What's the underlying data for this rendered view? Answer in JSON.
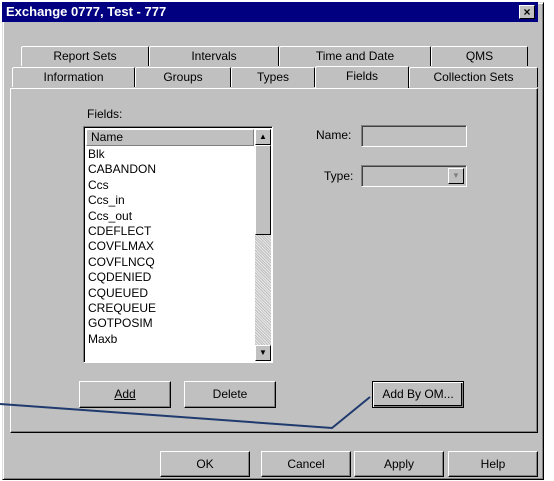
{
  "window": {
    "title": "Exchange 0777, Test - 777",
    "close_glyph": "×"
  },
  "tabs": {
    "row1": [
      "Report Sets",
      "Intervals",
      "Time and Date",
      "QMS"
    ],
    "row2": [
      "Information",
      "Groups",
      "Types",
      "Fields",
      "Collection Sets"
    ],
    "active": "Fields"
  },
  "fields_panel": {
    "list_label": "Fields:",
    "list_header": "Name",
    "items": [
      "Blk",
      "CABANDON",
      "Ccs",
      "Ccs_in",
      "Ccs_out",
      "CDEFLECT",
      "COVFLMAX",
      "COVFLNCQ",
      "CQDENIED",
      "CQUEUED",
      "CREQUEUE",
      "GOTPOSIM",
      "Maxb"
    ],
    "name_label": "Name:",
    "name_value": "",
    "type_label": "Type:",
    "type_value": "",
    "add_button": "Add",
    "delete_button": "Delete",
    "add_by_om_button": "Add By OM..."
  },
  "footer": {
    "ok": "OK",
    "cancel": "Cancel",
    "apply": "Apply",
    "help": "Help"
  },
  "annotation": {
    "color": "#1f3a6e"
  }
}
